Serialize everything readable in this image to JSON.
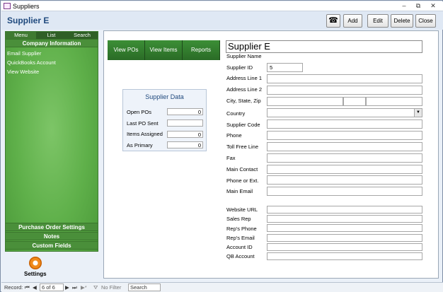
{
  "window": {
    "title": "Suppliers",
    "minimize": "–",
    "restore": "⧉",
    "close": "✕"
  },
  "header": {
    "form_title": "Supplier E",
    "buttons": {
      "phone_icon": "☎",
      "add": "Add",
      "edit": "Edit",
      "delete": "Delete",
      "close": "Close"
    }
  },
  "nav": {
    "tabs": [
      "Menu",
      "List",
      "Search"
    ],
    "company_section": "Company Information",
    "links": [
      "Email Supplier",
      "QuickBooks Account",
      "View Website"
    ],
    "bottom_sections": [
      "Purchase Order Settings",
      "Notes",
      "Custom Fields"
    ],
    "settings_label": "Settings",
    "color": "#5fb04a"
  },
  "tabs": {
    "view_pos": "View POs",
    "view_items": "View Items",
    "reports": "Reports"
  },
  "supplier_data": {
    "title": "Supplier Data",
    "rows": [
      {
        "label": "Open POs",
        "value": "0"
      },
      {
        "label": "Last PO Sent",
        "value": ""
      },
      {
        "label": "Items Assigned",
        "value": "0"
      },
      {
        "label": "As Primary",
        "value": "0"
      }
    ]
  },
  "form": {
    "supplier_name_value": "Supplier E",
    "supplier_name_label": "Supplier Name",
    "supplier_id_label": "Supplier ID",
    "supplier_id_value": "5",
    "address1_label": "Address Line 1",
    "address2_label": "Address Line 2",
    "city_state_zip_label": "City, State, Zip",
    "country_label": "Country",
    "supplier_code_label": "Supplier Code",
    "phone_label": "Phone",
    "toll_free_label": "Toll Free Line",
    "fax_label": "Fax",
    "main_contact_label": "Main Contact",
    "phone_ext_label": "Phone or Ext.",
    "main_email_label": "Main Email",
    "website_label": "Website URL",
    "sales_rep_label": "Sales Rep",
    "rep_phone_label": "Rep's Phone",
    "rep_email_label": "Rep's Email",
    "account_id_label": "Account ID",
    "qb_account_label": "QB Account"
  },
  "status_bar": {
    "record_label": "Record:",
    "record_value": "6 of 6",
    "filter_label": "No Filter",
    "search_label": "Search"
  }
}
